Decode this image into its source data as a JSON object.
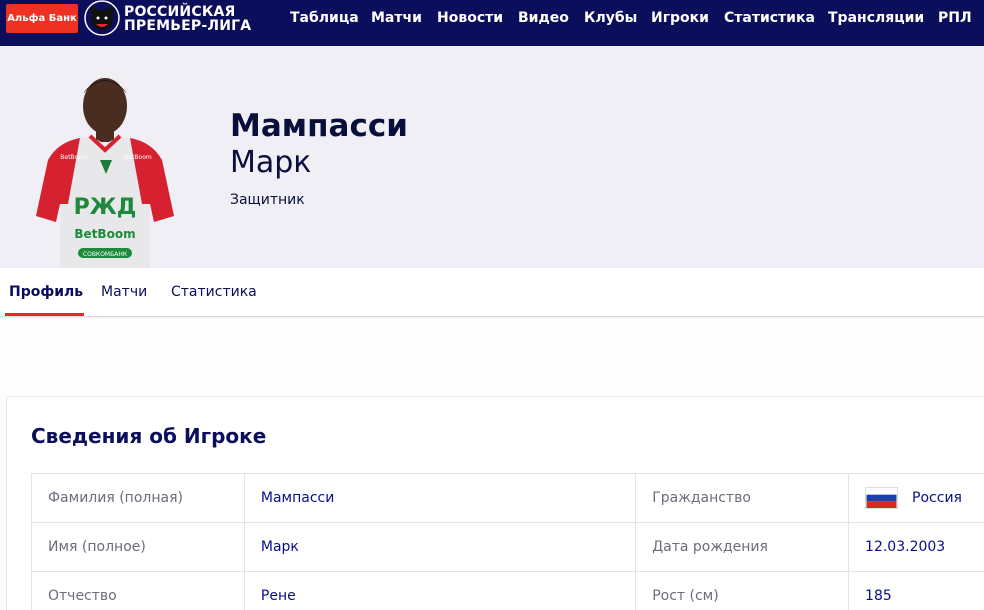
{
  "header": {
    "sponsor": "Альфа Банк",
    "brand_line1": "РОССИЙСКАЯ",
    "brand_line2": "ПРЕМЬЕР-ЛИГА",
    "nav": [
      "Таблица",
      "Матчи",
      "Новости",
      "Видео",
      "Клубы",
      "Игроки",
      "Статистика",
      "Трансляции",
      "РПЛ"
    ]
  },
  "player": {
    "surname": "Мампасси",
    "firstname": "Марк",
    "position": "Защитник",
    "shirt_sponsor": "BetBoom",
    "shirt_badge": "РЖД",
    "shirt_small": "СОВКОМБАНК",
    "shirt_chest": "BetBoom"
  },
  "tabs": [
    "Профиль",
    "Матчи",
    "Статистика"
  ],
  "info": {
    "title": "Сведения об Игроке",
    "rows": [
      {
        "l1": "Фамилия (полная)",
        "v1": "Мампасси",
        "l2": "Гражданство",
        "v2": "Россия"
      },
      {
        "l1": "Имя (полное)",
        "v1": "Марк",
        "l2": "Дата рождения",
        "v2": "12.03.2003"
      },
      {
        "l1": "Отчество",
        "v1": "Рене",
        "l2": "Рост (см)",
        "v2": "185"
      }
    ]
  },
  "colors": {
    "nav_bg": "#0a0e5b",
    "accent_red": "#e7262e",
    "text_dark": "#0a0e3b"
  }
}
